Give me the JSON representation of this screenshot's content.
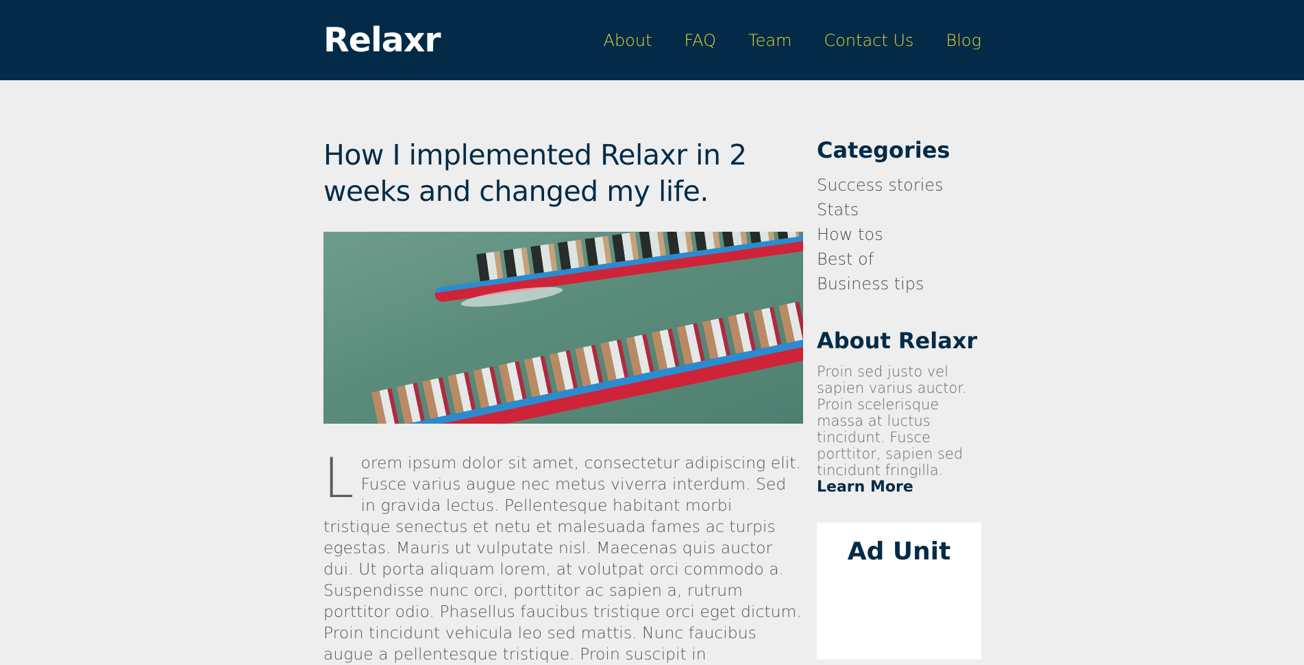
{
  "header": {
    "logo": "Relaxr",
    "nav": [
      "About",
      "FAQ",
      "Team",
      "Contact Us",
      "Blog"
    ]
  },
  "post": {
    "title": "How I implemented Relaxr in 2 weeks and changed my life.",
    "drop_cap": "L",
    "body": "orem ipsum dolor sit amet, consectetur adipiscing elit. Fusce varius augue nec metus viverra interdum. Sed in gravida lectus. Pellentesque habitant morbi tristique senectus et netu et malesuada fames ac turpis egestas. Mauris ut vulputate nisl. Maecenas quis auctor dui. Ut porta aliquam lorem, at volutpat orci commodo a. Suspendisse nunc orci, porttitor ac sapien a, rutrum porttitor odio. Phasellus faucibus tristique orci eget dictum. Proin tincidunt vehicula leo sed mattis. Nunc faucibus augue a pellentesque tristique. Proin suscipit in"
  },
  "sidebar": {
    "categories_heading": "Categories",
    "categories": [
      "Success stories",
      "Stats",
      "How tos",
      "Best of",
      "Business tips"
    ],
    "about_heading": "About Relaxr",
    "about_text": "Proin sed justo vel sapien varius auctor. Proin scelerisque massa at luctus tincidunt. Fusce porttitor, sapien sed tincidunt fringilla.",
    "learn_more": "Learn More",
    "ad_label": "Ad Unit"
  },
  "colors": {
    "header_bg": "#032b47",
    "nav_link": "#e6d434",
    "page_bg": "#eeeeee"
  }
}
